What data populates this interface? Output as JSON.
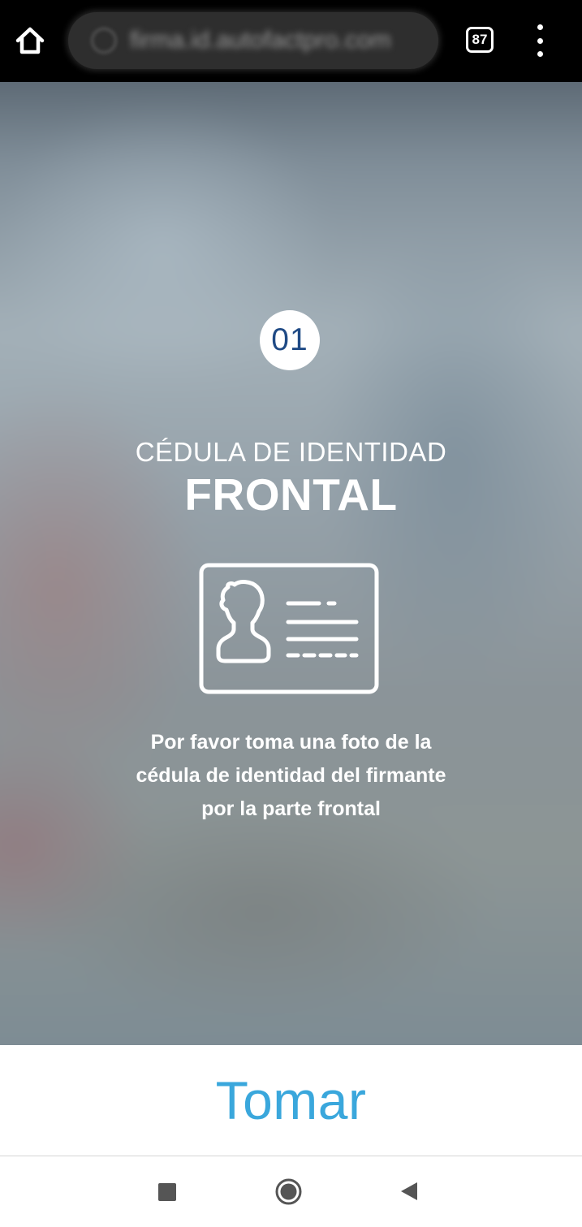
{
  "browser": {
    "url": "firma.id.autofactpro.com",
    "tab_count": "87",
    "icons": {
      "home": "home-icon",
      "loading": "loading-spinner-icon",
      "menu": "more-vert-icon"
    }
  },
  "step": {
    "number": "01"
  },
  "document": {
    "type": "CÉDULA DE IDENTIDAD",
    "side": "FRONTAL",
    "icon": "id-card-icon"
  },
  "instructions": {
    "line1": "Por favor toma una foto de la",
    "line2": "cédula de identidad del firmante",
    "line3": "por la parte frontal"
  },
  "action": {
    "take_label": "Tomar"
  },
  "system_nav": {
    "icons": [
      "recents-icon",
      "home-circle-icon",
      "back-icon"
    ]
  },
  "colors": {
    "accent": "#3aa7dc",
    "step_number": "#1f4a85",
    "browser_bar": "#000000"
  }
}
